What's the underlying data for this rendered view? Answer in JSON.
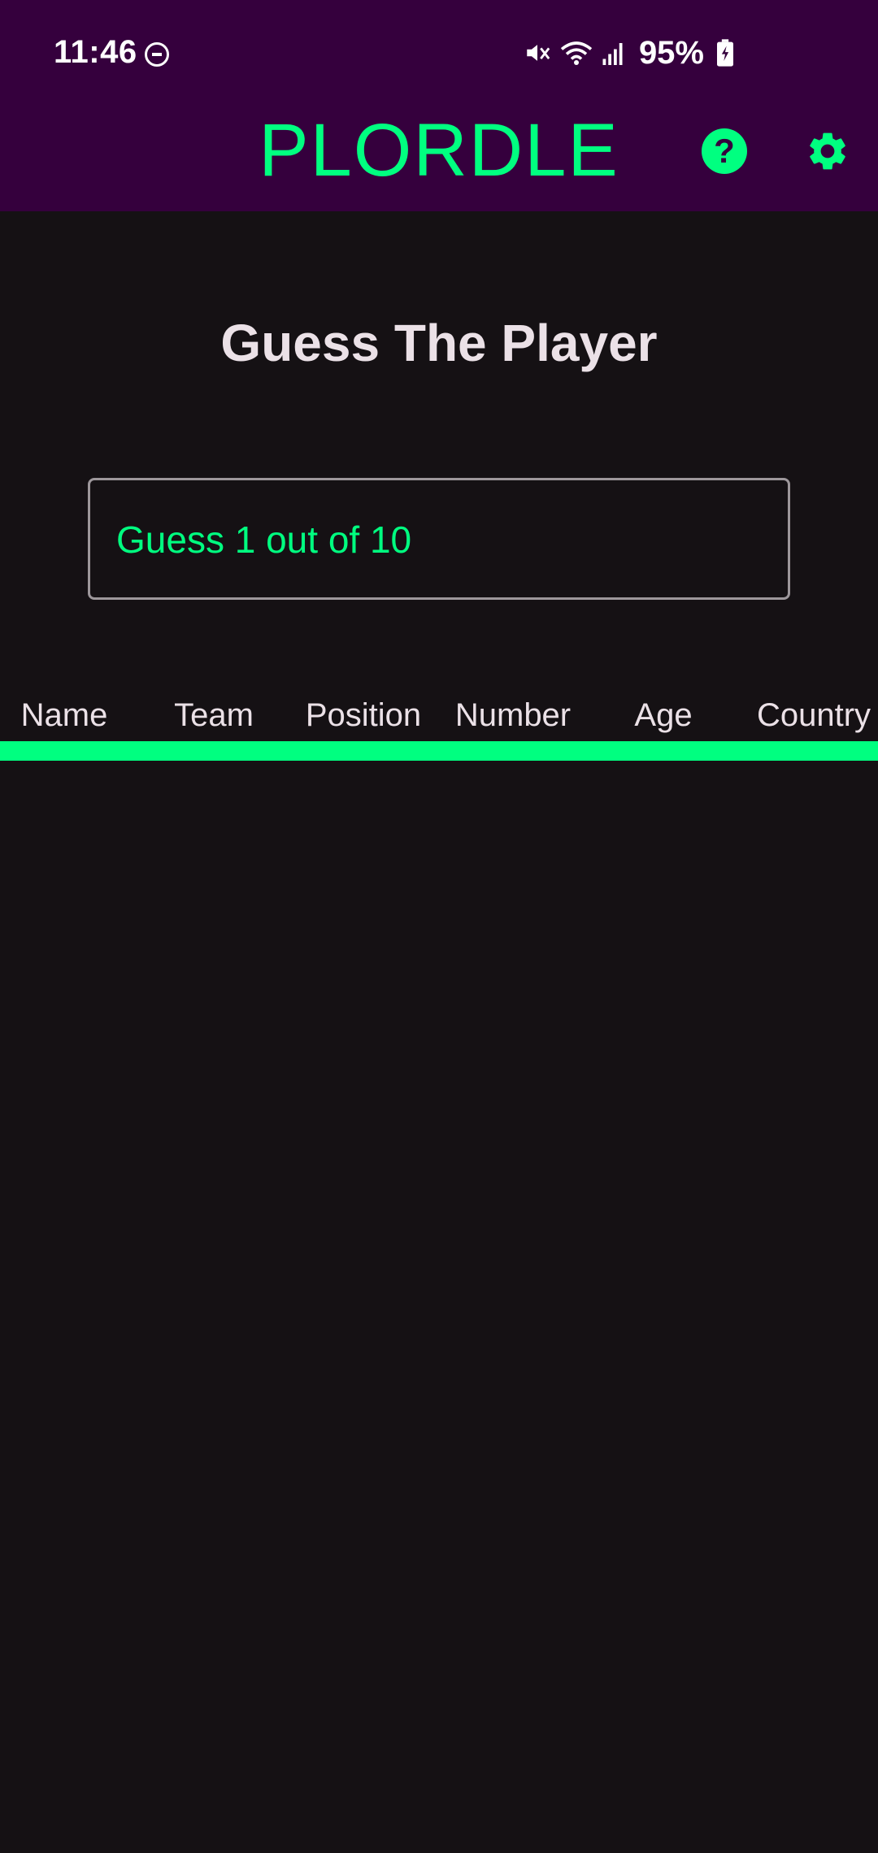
{
  "status_bar": {
    "time": "11:46",
    "battery": "95%",
    "icons": [
      "do-not-disturb-icon",
      "mute-icon",
      "wifi-icon",
      "signal-icon",
      "battery-charging-icon"
    ]
  },
  "app_bar": {
    "title": "PLORDLE",
    "help_icon": "help-circle-icon",
    "settings_icon": "gear-icon"
  },
  "main": {
    "title": "Guess The Player",
    "guess_counter": "Guess 1 out of 10"
  },
  "table": {
    "columns": [
      "Name",
      "Team",
      "Position",
      "Number",
      "Age",
      "Country"
    ],
    "rows": []
  },
  "colors": {
    "header_bg": "#35003d",
    "accent": "#00ff80",
    "background": "#151114",
    "text": "#ebe1e7",
    "border": "#9d979b"
  }
}
